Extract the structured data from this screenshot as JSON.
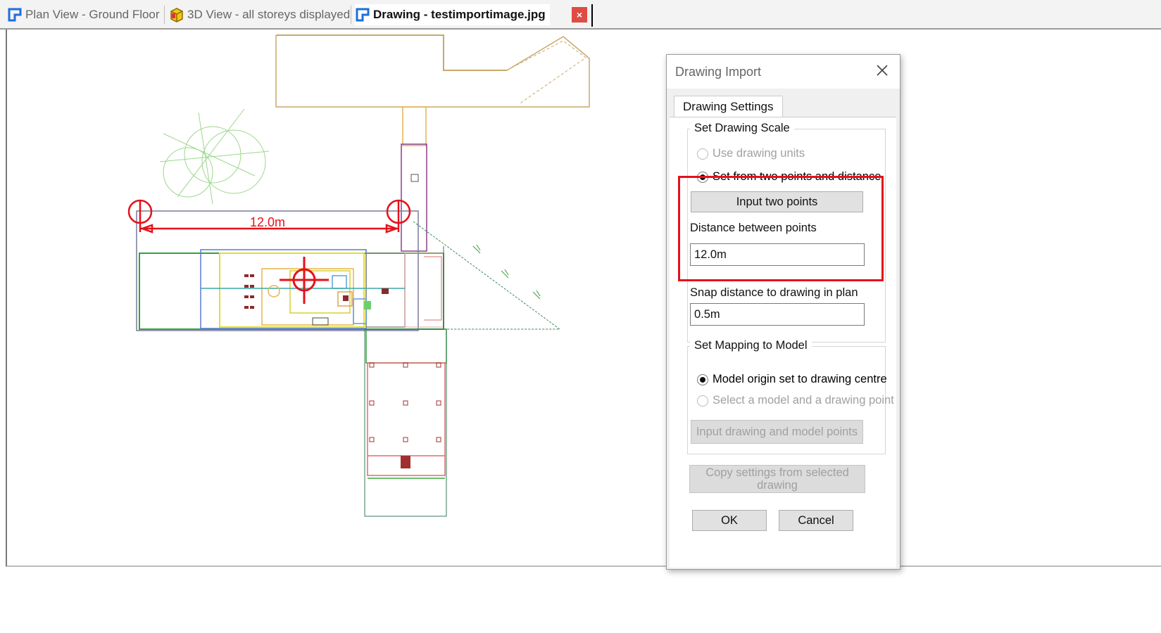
{
  "tabs": [
    {
      "label": "Plan View - Ground Floor",
      "icon": "plan-view-icon",
      "active": false
    },
    {
      "label": "3D View - all storeys displayed",
      "icon": "3d-view-icon",
      "active": false
    },
    {
      "label": "Drawing - testimportimage.jpg",
      "icon": "drawing-icon",
      "active": true
    }
  ],
  "close_tab_label": "×",
  "drawing": {
    "dimension_label": "12.0m"
  },
  "dialog": {
    "title": "Drawing Import",
    "tab_label": "Drawing Settings",
    "scale_group": {
      "label": "Set Drawing Scale",
      "option_drawing_units": "Use drawing units",
      "option_two_points": "Set from two points and distance",
      "input_two_points_button": "Input two points",
      "distance_label": "Distance between points",
      "distance_value": "12.0m",
      "snap_label": "Snap distance to drawing in plan",
      "snap_value": "0.5m"
    },
    "mapping_group": {
      "label": "Set Mapping to Model",
      "option_origin_centre": "Model origin set to drawing centre",
      "option_select_points": "Select a model and a drawing point",
      "input_points_button": "Input drawing and model points"
    },
    "copy_settings_button": "Copy settings from selected drawing",
    "ok_button": "OK",
    "cancel_button": "Cancel"
  },
  "colors": {
    "highlight_red": "#e3121b",
    "tab_close": "#e04b43",
    "accent_blue": "#1e6fd9"
  }
}
